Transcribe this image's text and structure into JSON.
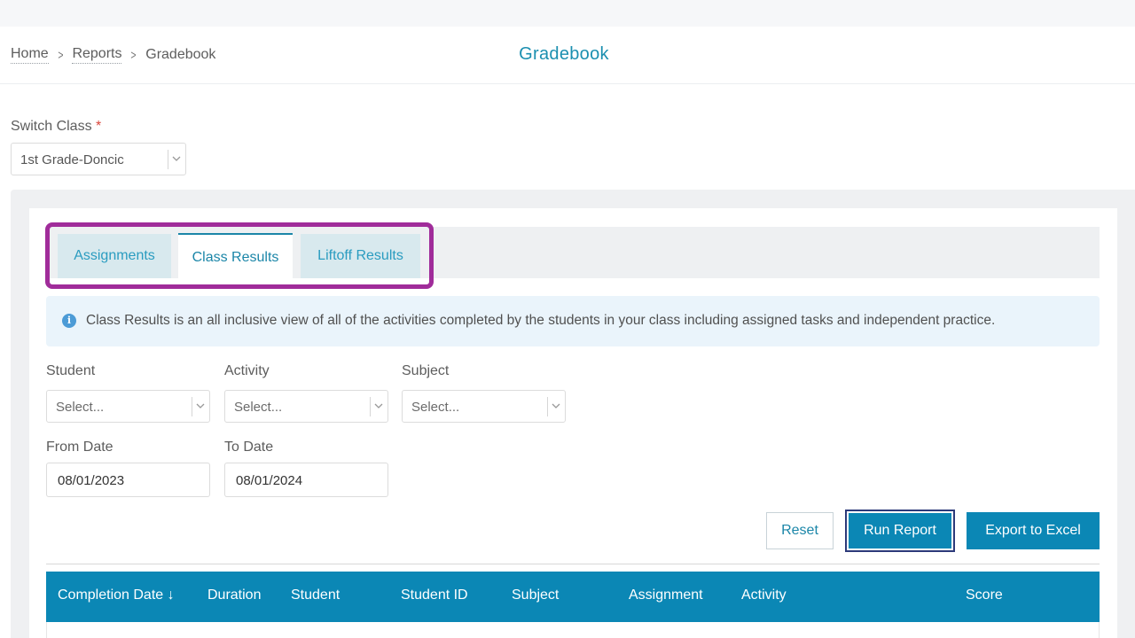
{
  "breadcrumb": {
    "items": [
      {
        "label": "Home"
      },
      {
        "label": "Reports"
      },
      {
        "label": "Gradebook"
      }
    ]
  },
  "page": {
    "title": "Gradebook"
  },
  "switch_class": {
    "label": "Switch Class",
    "required_mark": "*",
    "value": "1st Grade-Doncic"
  },
  "tabs": [
    {
      "label": "Assignments",
      "active": false
    },
    {
      "label": "Class Results",
      "active": true
    },
    {
      "label": "Liftoff Results",
      "active": false
    }
  ],
  "info": {
    "icon": "info-icon",
    "glyph": "i",
    "text": "Class Results is an all inclusive view of all of the activities completed by the students in your class including assigned tasks and independent practice."
  },
  "filters": {
    "student": {
      "label": "Student",
      "placeholder": "Select..."
    },
    "activity": {
      "label": "Activity",
      "placeholder": "Select..."
    },
    "subject": {
      "label": "Subject",
      "placeholder": "Select..."
    },
    "from_date": {
      "label": "From Date",
      "value": "08/01/2023"
    },
    "to_date": {
      "label": "To Date",
      "value": "08/01/2024"
    }
  },
  "buttons": {
    "reset": "Reset",
    "run_report": "Run Report",
    "export": "Export to Excel"
  },
  "table": {
    "columns": [
      {
        "label": "Completion Date",
        "sort": "↓"
      },
      {
        "label": "Duration"
      },
      {
        "label": "Student"
      },
      {
        "label": "Student ID"
      },
      {
        "label": "Subject"
      },
      {
        "label": "Assignment"
      },
      {
        "label": "Activity"
      },
      {
        "label": "Score"
      }
    ]
  },
  "colors": {
    "accent": "#0b87b5",
    "title": "#1b8fb0",
    "highlight": "#a02c9a",
    "required": "#d9463b"
  }
}
